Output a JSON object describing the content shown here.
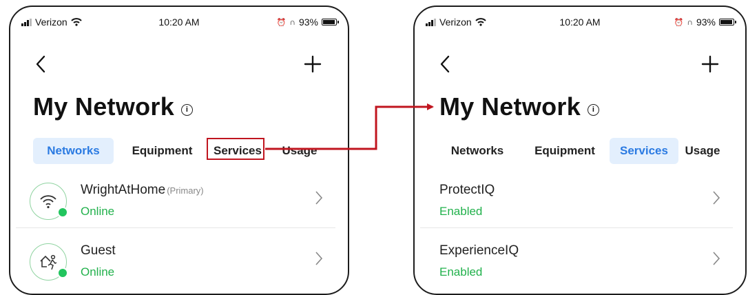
{
  "status_bar": {
    "carrier": "Verizon",
    "time": "10:20 AM",
    "battery": "93%"
  },
  "left_screen": {
    "title": "My Network",
    "tabs": [
      {
        "label": "Networks",
        "active": true
      },
      {
        "label": "Equipment",
        "active": false
      },
      {
        "label": "Services",
        "active": false
      },
      {
        "label": "Usage",
        "active": false
      }
    ],
    "rows": [
      {
        "name": "WrightAtHome",
        "tag": "(Primary)",
        "status": "Online",
        "icon": "wifi-icon"
      },
      {
        "name": "Guest",
        "tag": "",
        "status": "Online",
        "icon": "guest-network-icon"
      }
    ]
  },
  "right_screen": {
    "title": "My Network",
    "tabs": [
      {
        "label": "Networks",
        "active": false
      },
      {
        "label": "Equipment",
        "active": false
      },
      {
        "label": "Services",
        "active": true
      },
      {
        "label": "Usage",
        "active": false
      }
    ],
    "rows": [
      {
        "name": "ProtectIQ",
        "status": "Enabled"
      },
      {
        "name": "ExperienceIQ",
        "status": "Enabled"
      }
    ]
  },
  "annotation": {
    "highlight": "Services tab",
    "arrow_color": "#c0151f"
  },
  "colors": {
    "accent": "#2a7ae2",
    "active_tab_bg": "#e3effd",
    "online": "#22b14c",
    "annotation_red": "#c0151f"
  }
}
